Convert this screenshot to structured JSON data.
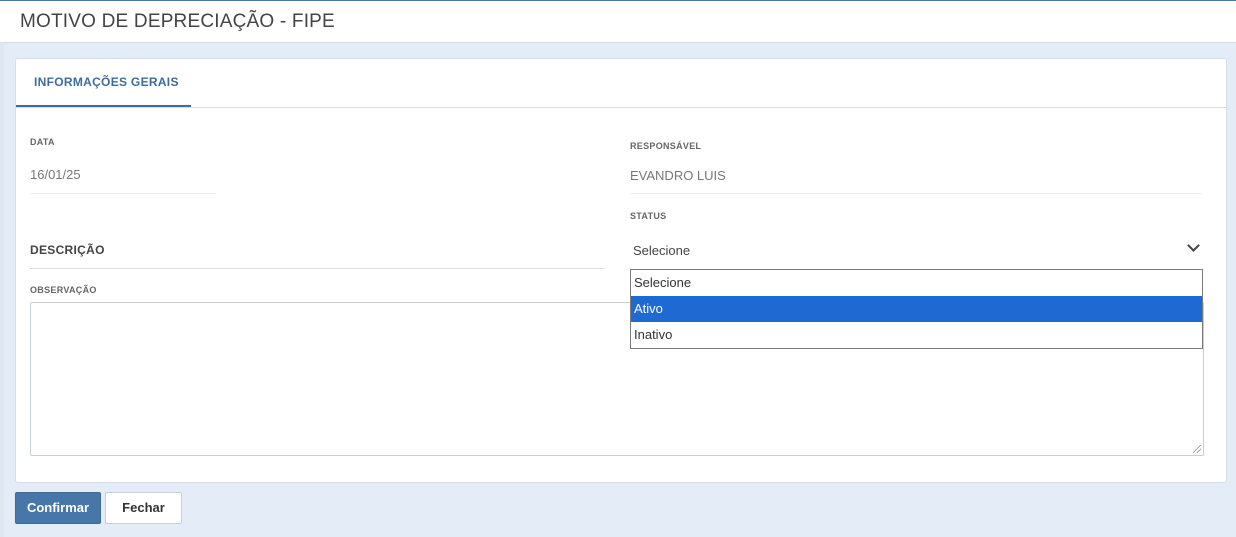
{
  "header": {
    "title": "MOTIVO DE DEPRECIAÇÃO - FIPE"
  },
  "tabs": [
    {
      "label": "INFORMAÇÕES GERAIS",
      "active": true
    }
  ],
  "form": {
    "data_label": "DATA",
    "data_value": "16/01/25",
    "responsavel_label": "RESPONSÁVEL",
    "responsavel_value": "EVANDRO LUIS",
    "status_label": "STATUS",
    "status_value": "Selecione",
    "descricao_label": "DESCRIÇÃO",
    "observacao_label": "OBSERVAÇÃO",
    "observacao_value": ""
  },
  "status_dropdown": {
    "options": [
      {
        "label": "Selecione",
        "highlighted": false
      },
      {
        "label": "Ativo",
        "highlighted": true
      },
      {
        "label": "Inativo",
        "highlighted": false
      }
    ]
  },
  "actions": {
    "confirm_label": "Confirmar",
    "close_label": "Fechar"
  },
  "colors": {
    "accent": "#3c6d9d",
    "highlight": "#1f6ad2",
    "background": "#e4ecf7"
  },
  "icons": {
    "select_arrow": "chevron-down-icon",
    "resize": "resize-grip-icon"
  }
}
